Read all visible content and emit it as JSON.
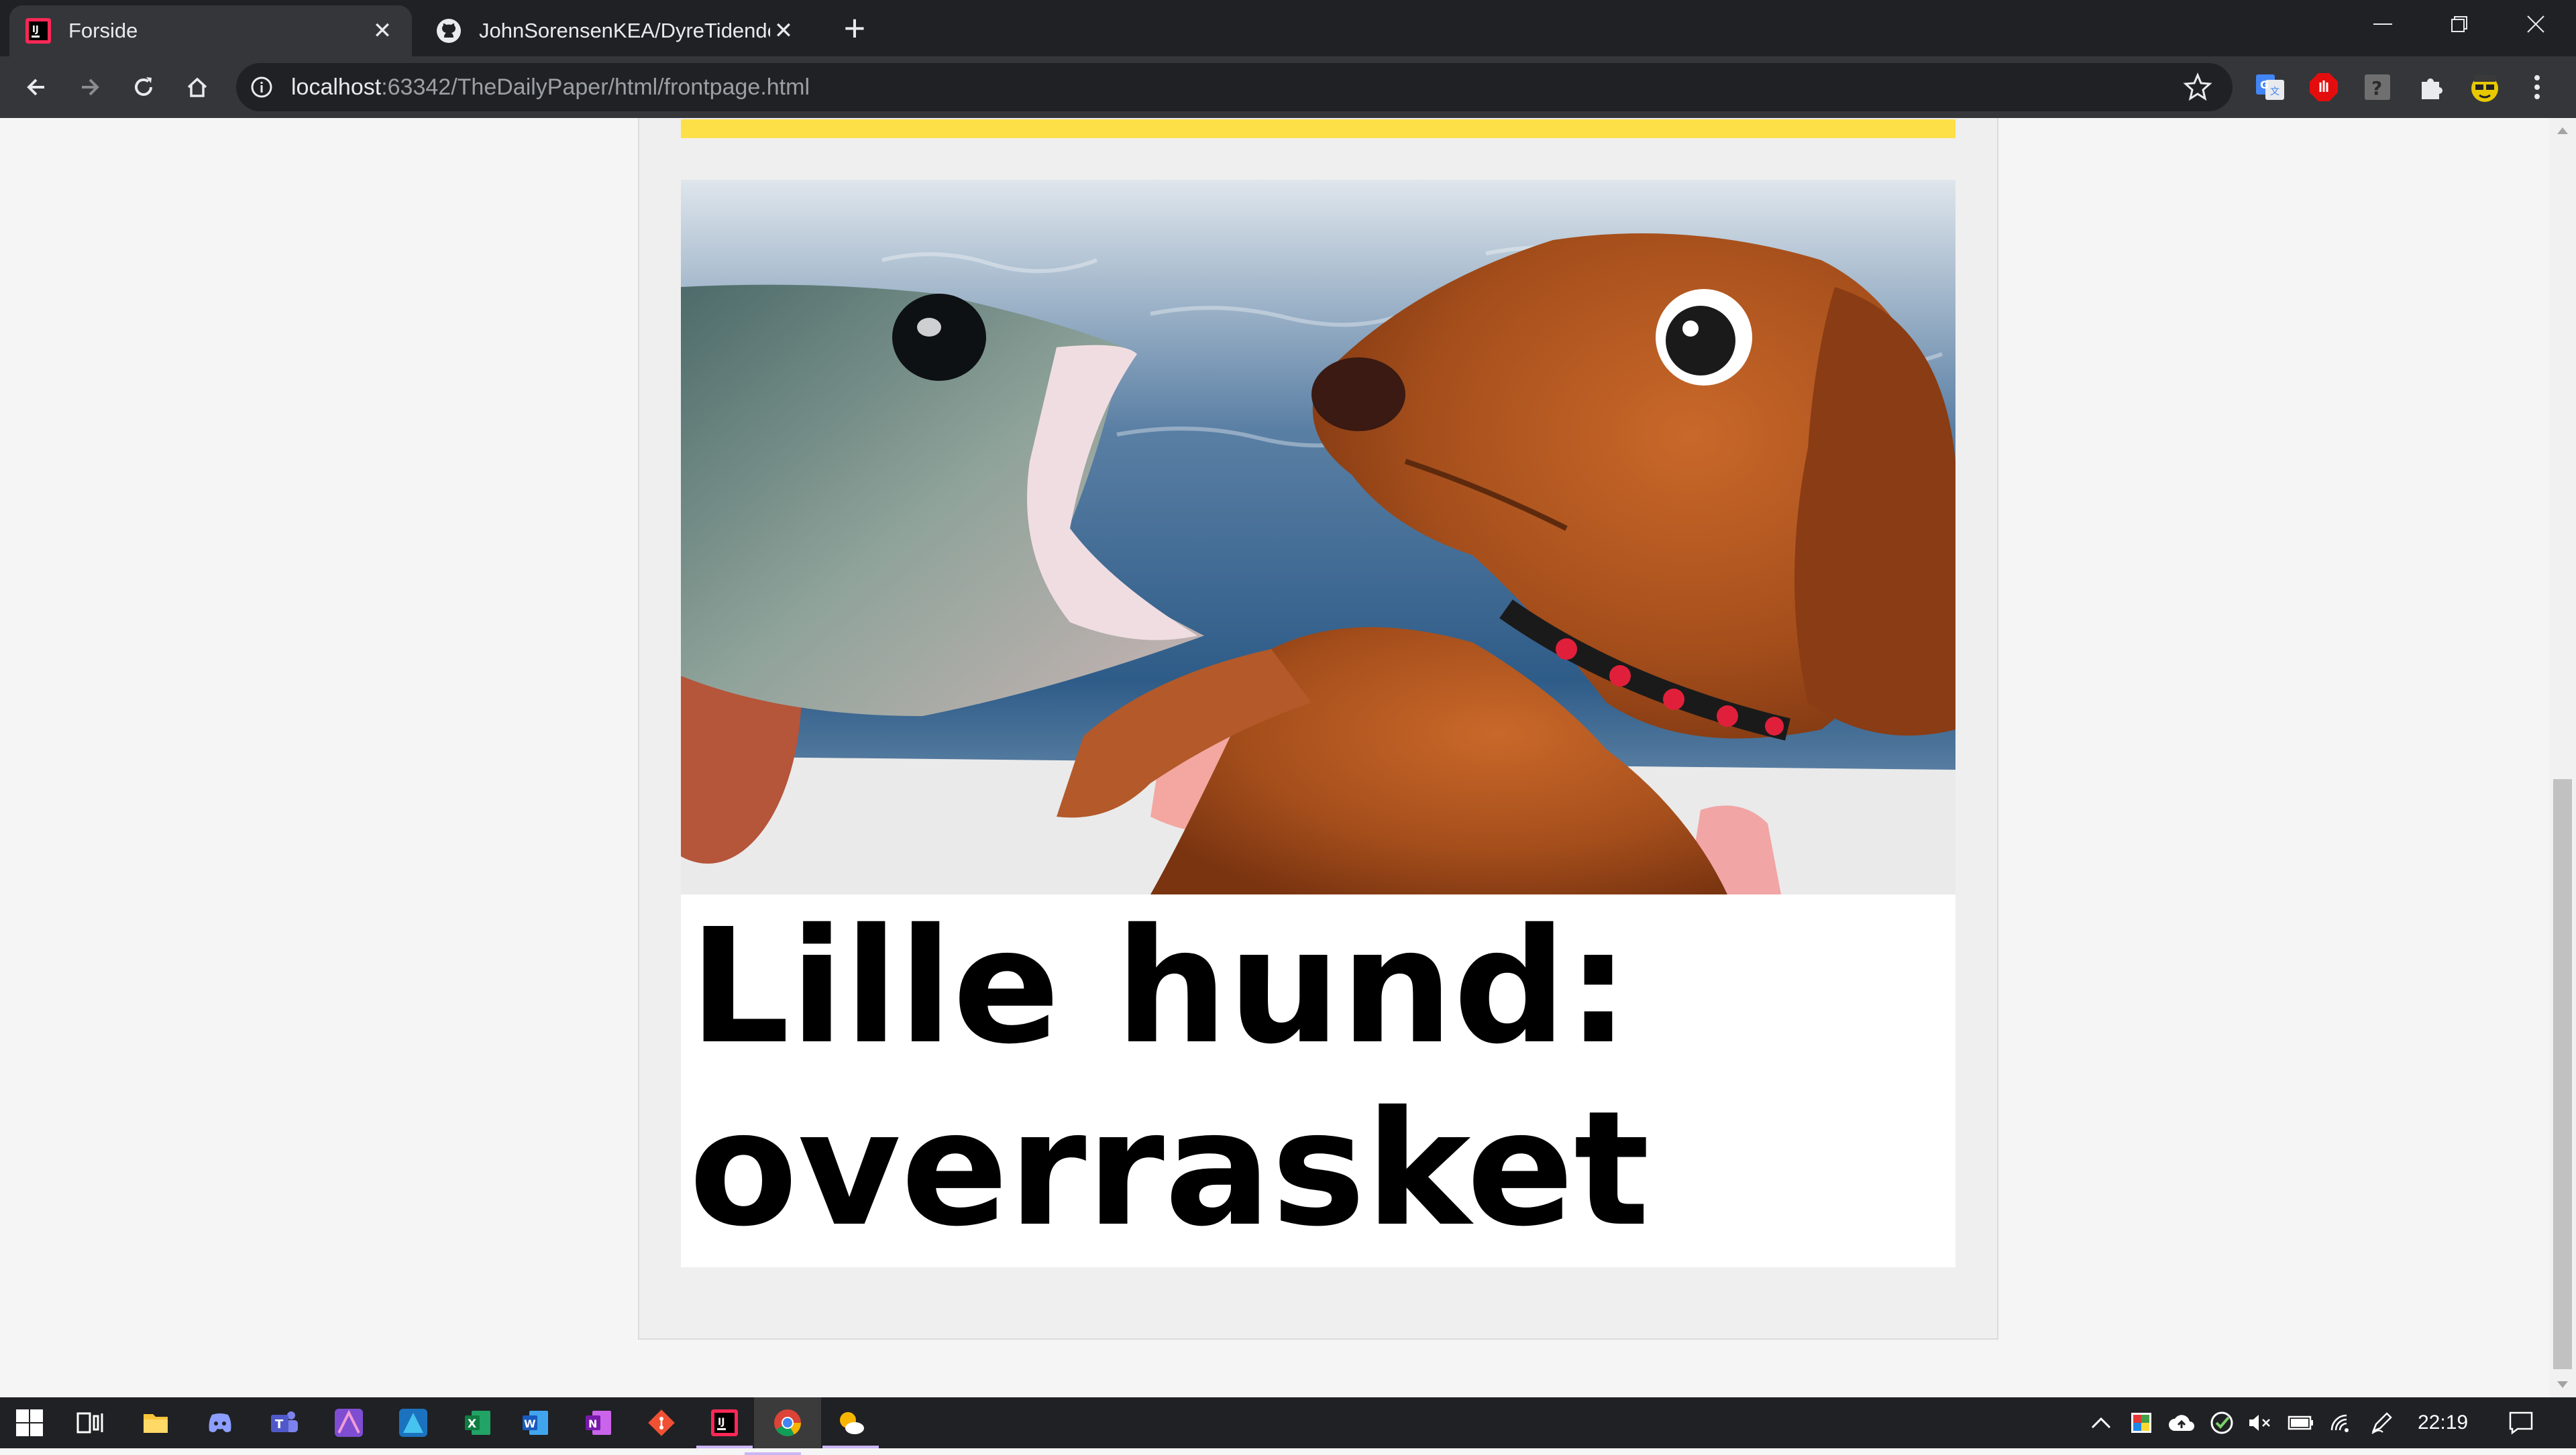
{
  "browser": {
    "tabs": [
      {
        "title": "Forside",
        "icon": "intellij-icon",
        "active": true
      },
      {
        "title": "JohnSorensenKEA/DyreTidende",
        "icon": "github-icon",
        "active": false
      }
    ],
    "url_host": "localhost",
    "url_path": ":63342/TheDailyPaper/html/frontpage.html",
    "extensions": [
      "google-translate-icon",
      "adblock-icon",
      "unknown-extension-icon",
      "extensions-puzzle-icon",
      "avatar-icon",
      "menu-icon"
    ]
  },
  "page": {
    "article": {
      "image_alt": "Fish with open mouth next to startled dachshund",
      "headline": "Lille hund: overrasket"
    },
    "colors": {
      "accent_bar": "#fde047",
      "background": "#efefef"
    }
  },
  "taskbar": {
    "apps": [
      "start-icon",
      "task-view-icon",
      "file-explorer-icon",
      "discord-icon",
      "teams-icon",
      "affinity-photo-icon",
      "affinity-designer-icon",
      "excel-icon",
      "word-icon",
      "onenote-icon",
      "git-icon",
      "intellij-icon",
      "chrome-icon",
      "weather-app-icon"
    ],
    "time": "22:19"
  }
}
